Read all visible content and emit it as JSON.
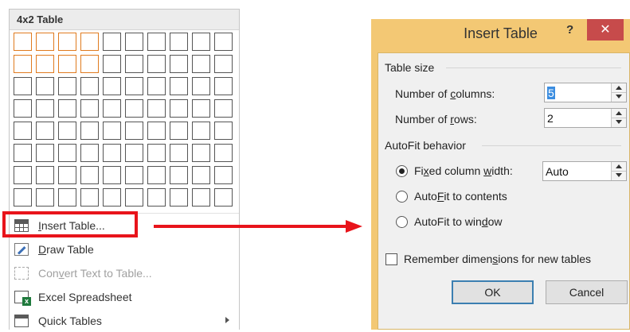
{
  "menu": {
    "header": "4x2 Table",
    "grid": {
      "columns": 10,
      "rows": 8,
      "highlighted_columns": 4,
      "highlighted_rows": 2
    },
    "items": [
      {
        "label": "Insert Table...",
        "underline": "I",
        "rest": "nsert Table...",
        "icon": "insert-table-icon",
        "disabled": false
      },
      {
        "label": "Draw Table",
        "underline": "D",
        "rest": "raw Table",
        "icon": "draw-table-icon",
        "disabled": false
      },
      {
        "label": "Convert Text to Table...",
        "pre": "Con",
        "underline": "v",
        "rest": "ert Text to Table...",
        "icon": "convert-text-icon",
        "disabled": true
      },
      {
        "label": "Excel Spreadsheet",
        "underline": "x",
        "icon": "excel-icon",
        "disabled": false
      },
      {
        "label": "Quick Tables",
        "underline": "T",
        "icon": "quick-tables-icon",
        "disabled": false,
        "has_submenu": true
      }
    ]
  },
  "dialog": {
    "title": "Insert Table",
    "help": "?",
    "close": "✕",
    "table_size_label": "Table size",
    "columns_label_pre": "Number of ",
    "columns_label_u": "c",
    "columns_label_post": "olumns:",
    "columns_value": "5",
    "rows_label_pre": "Number of ",
    "rows_label_u": "r",
    "rows_label_post": "ows:",
    "rows_value": "2",
    "autofit_label": "AutoFit behavior",
    "fixed_pre": "Fi",
    "fixed_u": "x",
    "fixed_mid": "ed column ",
    "fixed_u2": "w",
    "fixed_post": "idth:",
    "fixed_value": "Auto",
    "contents_pre": "Auto",
    "contents_u": "F",
    "contents_post": "it to contents",
    "window_pre": "AutoFit to win",
    "window_u": "d",
    "window_post": "ow",
    "remember_pre": "Remember dimen",
    "remember_u": "s",
    "remember_post": "ions for new tables",
    "ok": "OK",
    "cancel": "Cancel",
    "selected_option": "fixed",
    "remember_checked": false
  },
  "colors": {
    "accent_highlight": "#e8141b",
    "grid_highlight": "#e07b1f",
    "dialog_frame": "#f3c874",
    "close_button": "#c74b4b"
  }
}
